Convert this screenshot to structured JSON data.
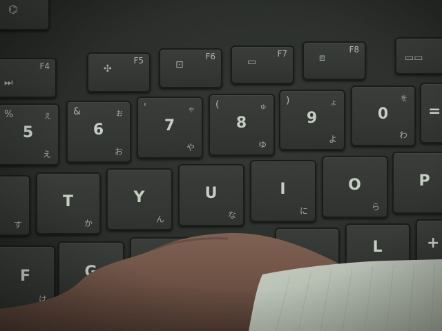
{
  "keys": {
    "f4": {
      "label": "F4",
      "icon": "⏭"
    },
    "f5": {
      "label": "F5",
      "icon": "✣"
    },
    "f6": {
      "label": "F6",
      "icon": "⊡"
    },
    "f7": {
      "label": "F7",
      "icon": "▭"
    },
    "f8": {
      "label": "F8",
      "icon": "⧈"
    },
    "k5": {
      "main": "5",
      "sym": "%",
      "kana": "え",
      "kana2": "え"
    },
    "k6": {
      "main": "6",
      "sym": "&",
      "kana": "お",
      "kana2": "お"
    },
    "k7": {
      "main": "7",
      "sym": "'",
      "kana": "や",
      "kana2": "ゃ"
    },
    "k8": {
      "main": "8",
      "sym": "(",
      "kana": "ゆ",
      "kana2": "ゅ"
    },
    "k9": {
      "main": "9",
      "sym": ")",
      "kana": "よ",
      "kana2": "ょ"
    },
    "k0": {
      "main": "0",
      "kana": "わ",
      "kana2": "を"
    },
    "t": {
      "main": "T",
      "kana": "か"
    },
    "y": {
      "main": "Y",
      "kana": "ん"
    },
    "u": {
      "main": "U",
      "kana": "な"
    },
    "i": {
      "main": "I",
      "kana": "に"
    },
    "o": {
      "main": "O",
      "kana": "ら"
    },
    "p": {
      "main": "P"
    },
    "r_left": {
      "kana": "す"
    },
    "f": {
      "main": "F",
      "kana": "は"
    },
    "g": {
      "main": "G"
    },
    "l": {
      "main": "L"
    },
    "plus": {
      "main": "+"
    },
    "eq": {
      "main": "="
    }
  },
  "colors": {
    "keycap": "#363936",
    "legend": "#c4cfc2",
    "skin": "#7a5c4e",
    "sleeve": "#b9c0b4"
  },
  "icons": [
    "skip-forward-icon",
    "fan-icon",
    "screen-icon",
    "display-icon",
    "touchpad-icon",
    "rog-logo-icon"
  ]
}
